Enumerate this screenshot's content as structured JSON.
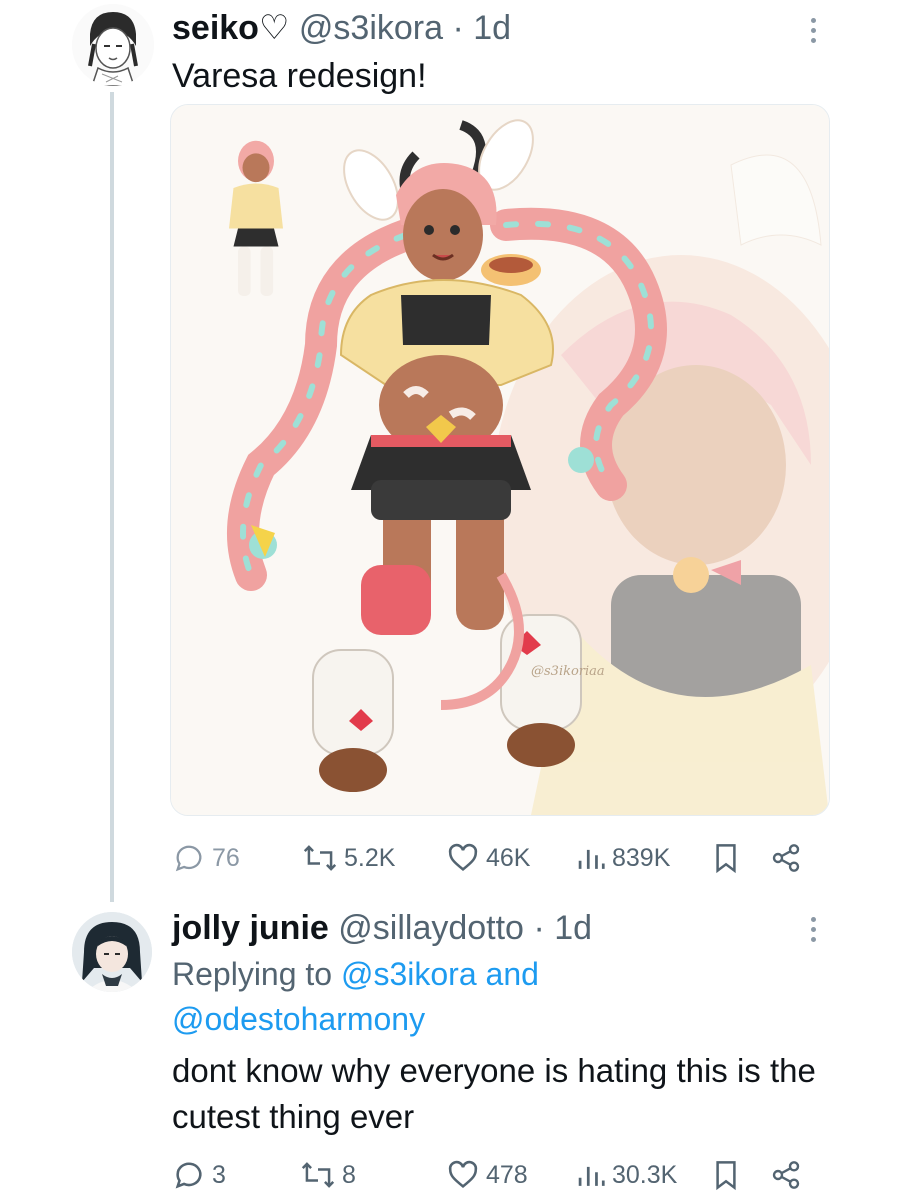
{
  "tweet1": {
    "name": "seiko♡",
    "handle": "@s3ikora",
    "separator": "·",
    "time": "1d",
    "text": "Varesa redesign!",
    "media": {
      "signature": "@s3ikoriaa"
    },
    "stats": {
      "replies": "76",
      "reposts": "5.2K",
      "likes": "46K",
      "views": "839K"
    }
  },
  "tweet2": {
    "name": "jolly junie",
    "handle": "@sillaydotto",
    "separator": "·",
    "time": "1d",
    "replying_prefix": "Replying to",
    "replying_user1": "@s3ikora",
    "replying_and": "and",
    "replying_user2": "@odestoharmony",
    "text": "dont know why everyone is hating this is the cutest thing ever",
    "stats": {
      "replies": "3",
      "reposts": "8",
      "likes": "478",
      "views": "30.3K"
    }
  },
  "icons": {
    "reply": "speech-bubble-icon",
    "repost": "repost-arrows-icon",
    "like": "heart-icon",
    "views": "bar-chart-icon",
    "bookmark": "bookmark-icon",
    "share": "share-icon",
    "more": "more-vertical-icon"
  },
  "colors": {
    "link": "#1d9bf0",
    "secondary_text": "#536471",
    "thread_line": "#cfd9de",
    "text": "#0f1419"
  }
}
